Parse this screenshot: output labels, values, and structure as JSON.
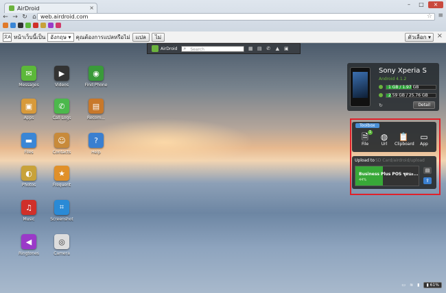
{
  "browser": {
    "tab_title": "AirDroid",
    "url": "web.airdroid.com"
  },
  "translate_bar": {
    "prompt": "หน้าเว็บนี้เป็น",
    "language": "อังกฤษ",
    "question": "คุณต้องการแปลหรือไม่",
    "translate_button": "แปล",
    "no_button": "ไม่",
    "options_button": "ตัวเลือก"
  },
  "dock": {
    "brand": "AirDroid",
    "search_placeholder": "Search"
  },
  "apps": [
    {
      "label": "Messages",
      "color": "#5cb83a",
      "icon": "message-icon"
    },
    {
      "label": "Videos",
      "color": "#333333",
      "icon": "clapper-icon"
    },
    {
      "label": "Find Phone",
      "color": "#3a9a3a",
      "icon": "radar-icon"
    },
    {
      "label": "Apps",
      "color": "#d89a3a",
      "icon": "box-icon"
    },
    {
      "label": "Call Logs",
      "color": "#4cb84c",
      "icon": "phone-icon"
    },
    {
      "label": "Recom...",
      "color": "#c8782a",
      "icon": "store-icon"
    },
    {
      "label": "Files",
      "color": "#3a86d6",
      "icon": "folder-icon"
    },
    {
      "label": "Contacts",
      "color": "#c88a3a",
      "icon": "contact-icon"
    },
    {
      "label": "Help",
      "color": "#3a7fd0",
      "icon": "help-icon"
    },
    {
      "label": "Photos",
      "color": "#c8a23a",
      "icon": "photo-icon"
    },
    {
      "label": "Frequent",
      "color": "#e0902a",
      "icon": "frequent-icon"
    },
    {
      "label": "Music",
      "color": "#d0302a",
      "icon": "music-icon"
    },
    {
      "label": "Screenshot",
      "color": "#2a8ad6",
      "icon": "crop-icon"
    },
    {
      "label": "Ringtones",
      "color": "#9a3ac8",
      "icon": "speaker-icon"
    },
    {
      "label": "Camera",
      "color": "#dddddd",
      "icon": "camera-icon"
    }
  ],
  "device": {
    "name": "Sony Xperia S",
    "os": "Android 4.1.2",
    "ram_text": "1 GB / 1.97 GB",
    "ram_fraction": 0.51,
    "storage_text": "2.59 GB / 25.76 GB",
    "storage_fraction": 0.1,
    "detail_button": "Detail"
  },
  "toolbox": {
    "title": "Toolbox",
    "tools": [
      {
        "label": "File",
        "icon": "file-icon"
      },
      {
        "label": "Url",
        "icon": "globe-icon"
      },
      {
        "label": "Clipboard",
        "icon": "clipboard-icon"
      },
      {
        "label": "App",
        "icon": "app-icon"
      }
    ],
    "badge": "1"
  },
  "upload": {
    "label": "Upload to",
    "path": "SD Card/airdroid/upload",
    "file_name": "Business Plus POS ชุดนะ...",
    "percent_text": "44%",
    "progress_fraction": 0.44
  },
  "status": {
    "battery": "61%"
  }
}
